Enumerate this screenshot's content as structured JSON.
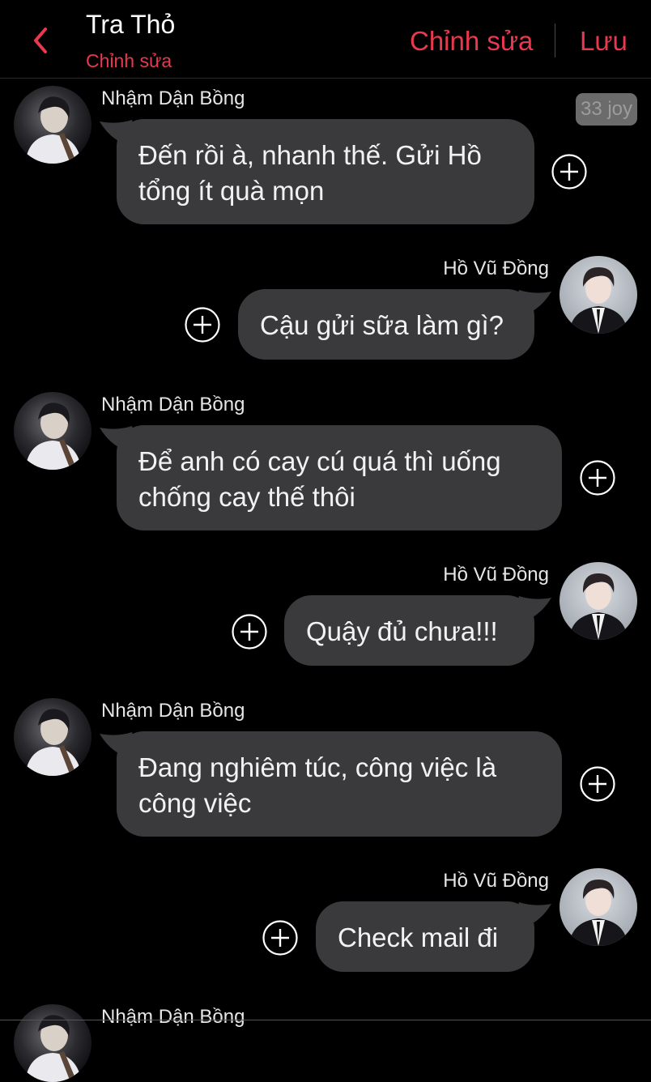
{
  "header": {
    "title": "Tra Thỏ",
    "subtitle": "Chỉnh sửa",
    "edit_label": "Chỉnh sửa",
    "save_label": "Lưu",
    "accent_color": "#e8394f"
  },
  "badge": "33 joy",
  "messages": [
    {
      "sender": "Nhậm Dận Bồng",
      "side": "left",
      "text": "Đến rồi à, nhanh thế. Gửi Hồ tổng ít quà mọn"
    },
    {
      "sender": "Hồ Vũ Đồng",
      "side": "right",
      "text": "Cậu gửi sữa làm gì?"
    },
    {
      "sender": "Nhậm Dận Bồng",
      "side": "left",
      "text": "Để anh có cay cú quá thì uống chống cay thế thôi"
    },
    {
      "sender": "Hồ Vũ Đồng",
      "side": "right",
      "text": "Quậy đủ chưa!!!"
    },
    {
      "sender": "Nhậm Dận Bồng",
      "side": "left",
      "text": "Đang nghiêm túc, công việc là công việc"
    },
    {
      "sender": "Hồ Vũ Đồng",
      "side": "right",
      "text": "Check mail đi"
    },
    {
      "sender": "Nhậm Dận Bồng",
      "side": "left",
      "text": ""
    }
  ],
  "icons": {
    "back": "chevron-left-icon",
    "add": "plus-circle-icon"
  }
}
